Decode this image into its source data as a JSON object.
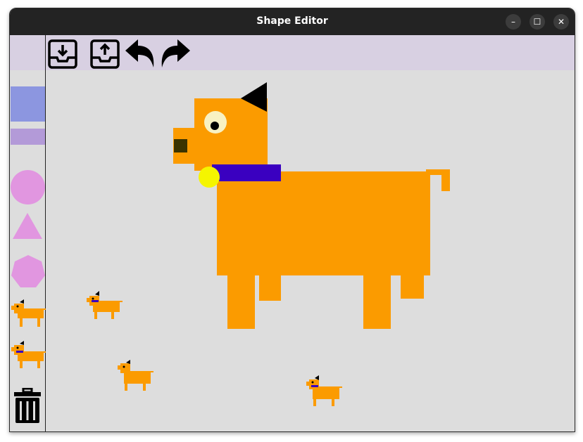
{
  "window": {
    "title": "Shape Editor",
    "controls": {
      "minimize": "–",
      "maximize": "☐",
      "close": "✕"
    }
  },
  "toolbar": {
    "tools": [
      "save-icon",
      "open-icon",
      "undo-icon",
      "redo-icon"
    ]
  },
  "palette": {
    "items": [
      "rectangle",
      "thin-rectangle",
      "circle",
      "triangle",
      "heptagon",
      "dog-plain",
      "dog-with-collar",
      "trash-icon"
    ],
    "colors": {
      "rect": "#8c96e0",
      "thin_rect": "#b39ad8",
      "shapes": "#e196e0"
    }
  },
  "colors": {
    "dog_body": "#fb9b00",
    "collar": "#3a00c0",
    "tag": "#f5f500",
    "nose": "#3a3300",
    "ear": "#000000",
    "canvas_bg": "#dddddd",
    "toolbar_bg": "#d8d0e2"
  }
}
